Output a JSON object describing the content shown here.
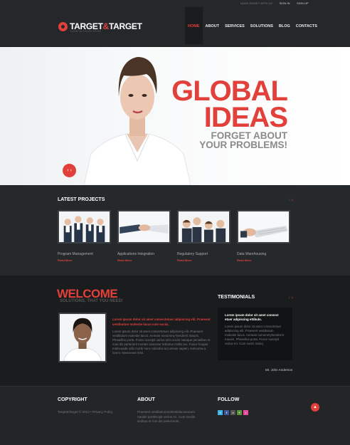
{
  "header": {
    "topbar": {
      "note": "MAKE MONEY WITH US",
      "sep": "·",
      "signin": "SIGN IN",
      "signup": "SIGN UP"
    },
    "logo": {
      "left": "TARGET",
      "amp": "&",
      "right": "TARGET",
      "tagline": "YOUR SLOGAN HERE"
    },
    "nav": [
      "HOME",
      "ABOUT",
      "SERVICES",
      "SOLUTIONS",
      "BLOG",
      "CONTACTS"
    ]
  },
  "hero": {
    "title_line1": "GLOBAL",
    "title_line2": "IDEAS",
    "sub_line1": "FORGET ABOUT",
    "sub_line2": "YOUR PROBLEMS!",
    "arrows": "‹ ›"
  },
  "projects": {
    "title": "LATEST PROJECTS",
    "prev": "‹",
    "next": "›",
    "items": [
      {
        "name": "Program Management",
        "more": "Read More"
      },
      {
        "name": "Applications Integration",
        "more": "Read More"
      },
      {
        "name": "Regulatory Support",
        "more": "Read More"
      },
      {
        "name": "Data Warehousing",
        "more": "Read More"
      }
    ]
  },
  "welcome": {
    "title": "WELCOME",
    "subtitle": "SOLUTIONS, THAT YOU NEED!",
    "lead": "Lorem ipsum dolor sit amet consectetuer adipiscing elit. Praesent vestibulum molestie lacus cum sociis.",
    "body": "Lorem ipsum dolor sit amet consectetuer adipiscing elit. Praesent vestibulum molestie lacus. Aenean nonummy hendrerit mauris. Phasellus porta. Fusce suscipit varius mim sociis natoque penatibus et mas dis parturient montes nascetur ridiculus mollis leo. Fusce feugiat malesuada odio morbi nunc odondra accumsan sapien, nuncurna a lorem. Maecenas tristi."
  },
  "testimonials": {
    "title": "TESTIMONIALS",
    "prev": "‹",
    "next": "›",
    "lead": "Lorem ipsum dolor sit amet connect etuer adipiscing ettibulo.",
    "body": "Lorem ipsum dolor sit amet consectetuer adipiscing elit. Praesent vestibulum molestie lacus. Aenean nonummyhendrerit mauris. Phasellus porta. Fusce suscipit varius mi. Cum sociis natoq",
    "author": "Mr. John Anderson"
  },
  "footer": {
    "copyright_title": "COPYRIGHT",
    "copyright_text": "Target&Target © 2012 • Privacy Policy",
    "about_title": "ABOUT",
    "about_text": "Praesent vestibulummolestielacusnouni nauitin porttiscipit verius mi. Cum sociiin seditus et mis dis parturients.",
    "follow_title": "FOLLOW",
    "social": [
      {
        "icon": "twitter-icon",
        "glyph": "t",
        "color": "#3fb3e6"
      },
      {
        "icon": "facebook-icon",
        "glyph": "f",
        "color": "#3b5998"
      },
      {
        "icon": "flickr-icon",
        "glyph": "••",
        "color": "#555555"
      },
      {
        "icon": "share-icon",
        "glyph": "+",
        "color": "#5b8f39"
      },
      {
        "icon": "dribbble-icon",
        "glyph": "•",
        "color": "#e84c9a"
      }
    ],
    "to_top": "▲"
  },
  "colors": {
    "accent": "#e2413b",
    "bg": "#1d1f21"
  }
}
